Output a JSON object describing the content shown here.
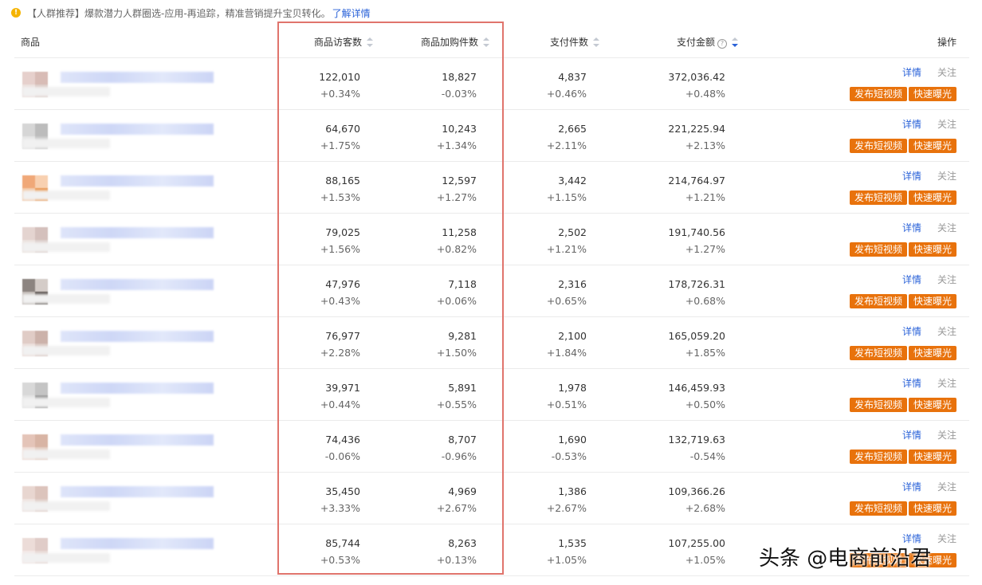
{
  "notice": {
    "text": "【人群推荐】爆款潜力人群圈选-应用-再追踪，精准营销提升宝贝转化。",
    "link": "了解详情"
  },
  "columns": {
    "product": "商品",
    "visitors": "商品访客数",
    "cart": "商品加购件数",
    "paid_items": "支付件数",
    "paid_amount": "支付金额",
    "actions": "操作"
  },
  "actions": {
    "detail": "详情",
    "follow": "关注",
    "publish_video": "发布短视频",
    "quick_expose": "快速曝光"
  },
  "rows": [
    {
      "visitors": "122,010",
      "visitors_delta": "+0.34%",
      "cart": "18,827",
      "cart_delta": "-0.03%",
      "paid_items": "4,837",
      "paid_items_delta": "+0.46%",
      "amount": "372,036.42",
      "amount_delta": "+0.48%"
    },
    {
      "visitors": "64,670",
      "visitors_delta": "+1.75%",
      "cart": "10,243",
      "cart_delta": "+1.34%",
      "paid_items": "2,665",
      "paid_items_delta": "+2.11%",
      "amount": "221,225.94",
      "amount_delta": "+2.13%"
    },
    {
      "visitors": "88,165",
      "visitors_delta": "+1.53%",
      "cart": "12,597",
      "cart_delta": "+1.27%",
      "paid_items": "3,442",
      "paid_items_delta": "+1.15%",
      "amount": "214,764.97",
      "amount_delta": "+1.21%"
    },
    {
      "visitors": "79,025",
      "visitors_delta": "+1.56%",
      "cart": "11,258",
      "cart_delta": "+0.82%",
      "paid_items": "2,502",
      "paid_items_delta": "+1.21%",
      "amount": "191,740.56",
      "amount_delta": "+1.27%"
    },
    {
      "visitors": "47,976",
      "visitors_delta": "+0.43%",
      "cart": "7,118",
      "cart_delta": "+0.06%",
      "paid_items": "2,316",
      "paid_items_delta": "+0.65%",
      "amount": "178,726.31",
      "amount_delta": "+0.68%"
    },
    {
      "visitors": "76,977",
      "visitors_delta": "+2.28%",
      "cart": "9,281",
      "cart_delta": "+1.50%",
      "paid_items": "2,100",
      "paid_items_delta": "+1.84%",
      "amount": "165,059.20",
      "amount_delta": "+1.85%"
    },
    {
      "visitors": "39,971",
      "visitors_delta": "+0.44%",
      "cart": "5,891",
      "cart_delta": "+0.55%",
      "paid_items": "1,978",
      "paid_items_delta": "+0.51%",
      "amount": "146,459.93",
      "amount_delta": "+0.50%"
    },
    {
      "visitors": "74,436",
      "visitors_delta": "-0.06%",
      "cart": "8,707",
      "cart_delta": "-0.96%",
      "paid_items": "1,690",
      "paid_items_delta": "-0.53%",
      "amount": "132,719.63",
      "amount_delta": "-0.54%"
    },
    {
      "visitors": "35,450",
      "visitors_delta": "+3.33%",
      "cart": "4,969",
      "cart_delta": "+2.67%",
      "paid_items": "1,386",
      "paid_items_delta": "+2.67%",
      "amount": "109,366.26",
      "amount_delta": "+2.68%"
    },
    {
      "visitors": "85,744",
      "visitors_delta": "+0.53%",
      "cart": "8,263",
      "cart_delta": "+0.13%",
      "paid_items": "1,535",
      "paid_items_delta": "+1.05%",
      "amount": "107,255.00",
      "amount_delta": "+1.05%"
    }
  ],
  "colors": {
    "accent": "#2a62d8",
    "button": "#e8720c",
    "highlight_box": "#e0746c"
  },
  "watermark": "头条 @电商前沿君"
}
